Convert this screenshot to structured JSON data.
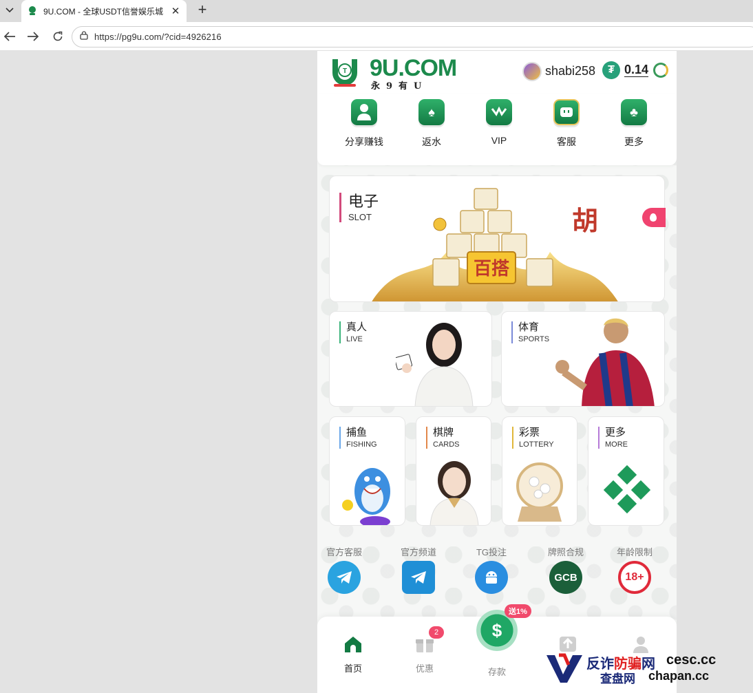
{
  "browser": {
    "tab_title": "9U.COM - 全球USDT信誉娱乐城",
    "url": "https://pg9u.com/?cid=4926216"
  },
  "header": {
    "logo_text": "9U.COM",
    "logo_sub": "永9有U",
    "username": "shabi258",
    "balance": "0.14"
  },
  "quick_nav": [
    {
      "label": "分享赚钱"
    },
    {
      "label": "返水"
    },
    {
      "label": "VIP"
    },
    {
      "label": "客服"
    },
    {
      "label": "更多"
    }
  ],
  "categories": {
    "slot": {
      "cn": "电子",
      "en": "SLOT",
      "art_text": "百搭"
    },
    "live": {
      "cn": "真人",
      "en": "LIVE"
    },
    "sports": {
      "cn": "体育",
      "en": "SPORTS"
    },
    "fishing": {
      "cn": "捕鱼",
      "en": "FISHING"
    },
    "cards": {
      "cn": "棋牌",
      "en": "CARDS"
    },
    "lottery": {
      "cn": "彩票",
      "en": "LOTTERY"
    },
    "more": {
      "cn": "更多",
      "en": "MORE"
    }
  },
  "footer_links": [
    {
      "label": "官方客服",
      "color": "#2aa3e0"
    },
    {
      "label": "官方频道",
      "color": "#1f8fd6"
    },
    {
      "label": "TG投注",
      "color": "#2a8ee0"
    },
    {
      "label": "牌照合规",
      "color": "#1b5f3a",
      "icon_text": "GCB"
    },
    {
      "label": "年龄限制",
      "color": "#e02a3a",
      "icon_text": "18+"
    }
  ],
  "bottom_nav": {
    "home": "首页",
    "promo": "优惠",
    "promo_badge": "2",
    "deposit": "存款",
    "deposit_badge": "送1%"
  },
  "watermark": {
    "cn_line1_a": "反诈",
    "cn_line1_b": "防骗",
    "cn_line1_c": "网",
    "cn_line2": "查盘网",
    "site1": "cesc.cc",
    "site2": "chapan.cc"
  },
  "colors": {
    "brand_green": "#1c8a4c",
    "accent_pink": "#f0436f"
  }
}
